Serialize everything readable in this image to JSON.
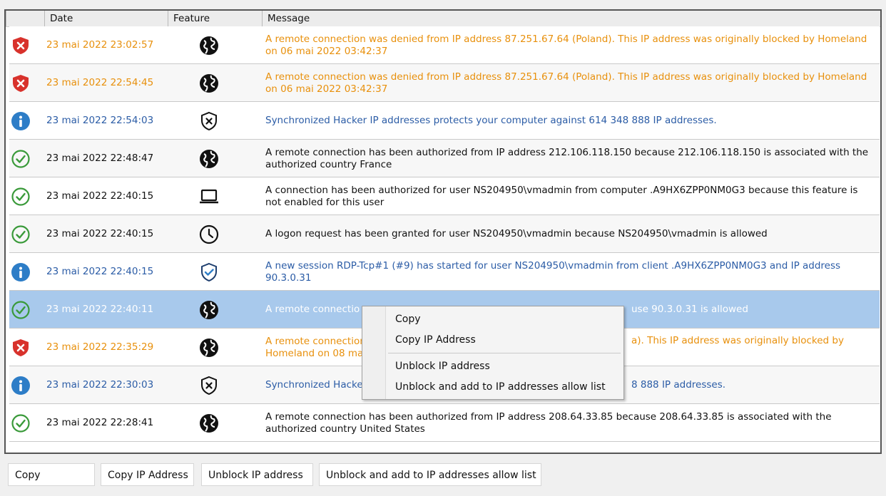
{
  "header": {
    "date": "Date",
    "feature": "Feature",
    "message": "Message"
  },
  "rows": [
    {
      "severity": "blocked",
      "feature_icon": "globe",
      "date": "23 mai 2022 23:02:57",
      "msg": "A remote connection was denied from IP address 87.251.67.64 (Poland). This IP address was originally blocked by Homeland on 06 mai 2022 03:42:37"
    },
    {
      "severity": "blocked",
      "feature_icon": "globe",
      "date": "23 mai 2022 22:54:45",
      "msg": "A remote connection was denied from IP address 87.251.67.64 (Poland). This IP address was originally blocked by Homeland on 06 mai 2022 03:42:37"
    },
    {
      "severity": "info",
      "feature_icon": "shield-x",
      "date": "23 mai 2022 22:54:03",
      "msg": "Synchronized Hacker IP addresses protects your computer against 614 348 888 IP addresses."
    },
    {
      "severity": "allowed",
      "feature_icon": "globe",
      "date": "23 mai 2022 22:48:47",
      "msg": "A remote connection has been authorized from IP address 212.106.118.150 because 212.106.118.150 is associated with the authorized country France"
    },
    {
      "severity": "allowed",
      "feature_icon": "laptop",
      "date": "23 mai 2022 22:40:15",
      "msg": "A connection has been authorized for user NS204950\\vmadmin from computer .A9HX6ZPP0NM0G3 because this feature is not enabled for this user"
    },
    {
      "severity": "allowed",
      "feature_icon": "clock",
      "date": "23 mai 2022 22:40:15",
      "msg": "A logon request has been granted for user NS204950\\vmadmin because NS204950\\vmadmin is allowed"
    },
    {
      "severity": "info",
      "feature_icon": "shield-check",
      "date": "23 mai 2022 22:40:15",
      "msg": "A new session RDP-Tcp#1 (#9) has started for user NS204950\\vmadmin from client .A9HX6ZPP0NM0G3 and IP address 90.3.0.31"
    },
    {
      "severity": "allowed",
      "feature_icon": "globe",
      "date": "23 mai 2022 22:40:11",
      "msg": "A remote connectio",
      "msg_tail": "use 90.3.0.31 is allowed",
      "selected": true
    },
    {
      "severity": "blocked",
      "feature_icon": "globe",
      "date": "23 mai 2022 22:35:29",
      "msg": "A remote connection",
      "msg_line2": "Homeland on 08 ma",
      "msg_tail": "a). This IP address was originally blocked by"
    },
    {
      "severity": "info",
      "feature_icon": "shield-x",
      "date": "23 mai 2022 22:30:03",
      "msg": "Synchronized Hacke",
      "msg_tail": "8 888 IP addresses."
    },
    {
      "severity": "allowed",
      "feature_icon": "globe",
      "date": "23 mai 2022 22:28:41",
      "msg": "A remote connection has been authorized from IP address 208.64.33.85 because 208.64.33.85 is associated with the authorized country United States"
    }
  ],
  "context_menu": {
    "items": [
      "Copy",
      "Copy IP Address",
      "Unblock IP address",
      "Unblock and add to IP addresses allow list"
    ]
  },
  "buttons": {
    "copy": "Copy",
    "copy_ip": "Copy IP Address",
    "unblock_ip": "Unblock IP address",
    "unblock_allow": "Unblock and add to IP addresses allow list"
  },
  "colors": {
    "blocked_text": "#e8900c",
    "info_text": "#2b5ca6",
    "selected_row": "#a8c9ec",
    "blocked_shield": "#d8322c",
    "info_circle": "#2d7dc7",
    "allowed_check": "#3a9a3a"
  }
}
